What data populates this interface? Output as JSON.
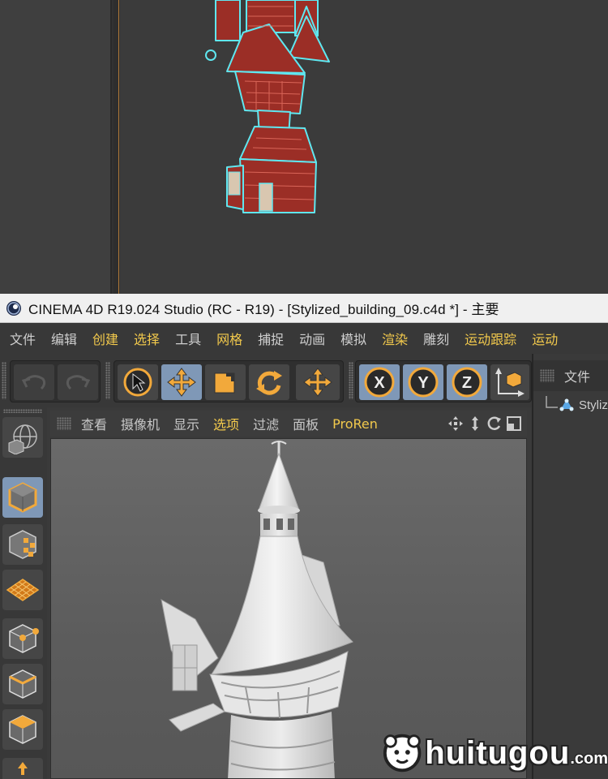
{
  "window": {
    "title": "CINEMA 4D R19.024 Studio (RC - R19) - [Stylized_building_09.c4d *] - 主要"
  },
  "menubar": {
    "items": [
      {
        "label": "文件",
        "highlighted": false
      },
      {
        "label": "编辑",
        "highlighted": false
      },
      {
        "label": "创建",
        "highlighted": true
      },
      {
        "label": "选择",
        "highlighted": true
      },
      {
        "label": "工具",
        "highlighted": false
      },
      {
        "label": "网格",
        "highlighted": true
      },
      {
        "label": "捕捉",
        "highlighted": false
      },
      {
        "label": "动画",
        "highlighted": false
      },
      {
        "label": "模拟",
        "highlighted": false
      },
      {
        "label": "渲染",
        "highlighted": true
      },
      {
        "label": "雕刻",
        "highlighted": false
      },
      {
        "label": "运动跟踪",
        "highlighted": true
      },
      {
        "label": "运动",
        "highlighted": true
      }
    ]
  },
  "toolbar": {
    "undo_icon": "undo-icon",
    "redo_icon": "redo-icon",
    "tools": [
      "select-arrow-icon",
      "move-icon",
      "scale-icon",
      "rotate-icon",
      "move-last-icon"
    ],
    "axes": [
      "X",
      "Y",
      "Z"
    ],
    "coord_icon": "world-coordinates-icon"
  },
  "viewport": {
    "menu": [
      {
        "label": "查看",
        "highlighted": false
      },
      {
        "label": "摄像机",
        "highlighted": false
      },
      {
        "label": "显示",
        "highlighted": false
      },
      {
        "label": "选项",
        "highlighted": true
      },
      {
        "label": "过滤",
        "highlighted": false
      },
      {
        "label": "面板",
        "highlighted": false
      },
      {
        "label": "ProRen",
        "highlighted": true
      }
    ]
  },
  "object_manager": {
    "tab_label": "文件",
    "object_name": "Styliz"
  },
  "left_palette": {
    "tools": [
      "globe-cube-icon",
      "model-mode-icon",
      "texture-mode-icon",
      "workplane-icon",
      "points-mode-icon",
      "edges-mode-icon",
      "polygons-mode-icon"
    ]
  },
  "watermark": {
    "text": "huitugou",
    "suffix": ".com"
  },
  "colors": {
    "accent_orange": "#f2a93b",
    "active_blue": "#7f98b7",
    "highlight_yellow": "#f2c94c",
    "selection_cyan": "#5fe7f0"
  }
}
